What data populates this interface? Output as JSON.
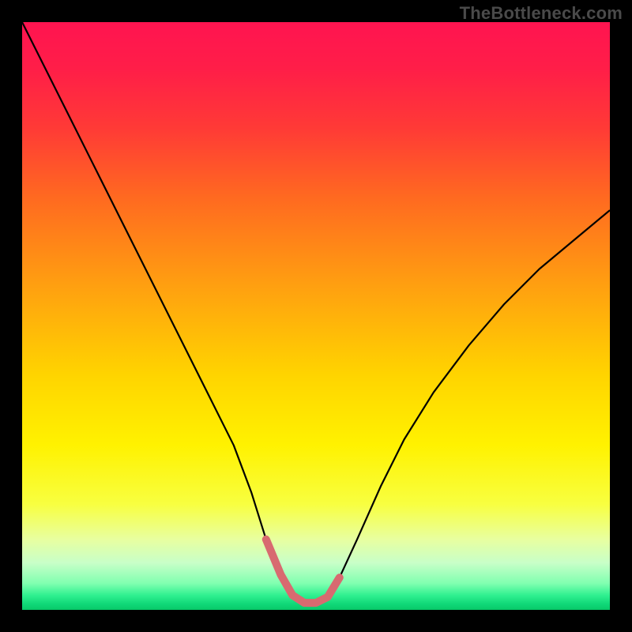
{
  "watermark": {
    "text": "TheBottleneck.com"
  },
  "gradient": {
    "stops": [
      {
        "offset": 0.0,
        "color": "#ff1450"
      },
      {
        "offset": 0.08,
        "color": "#ff1e48"
      },
      {
        "offset": 0.18,
        "color": "#ff3a36"
      },
      {
        "offset": 0.3,
        "color": "#ff6a20"
      },
      {
        "offset": 0.45,
        "color": "#ffa010"
      },
      {
        "offset": 0.6,
        "color": "#ffd400"
      },
      {
        "offset": 0.72,
        "color": "#fff200"
      },
      {
        "offset": 0.82,
        "color": "#f8ff40"
      },
      {
        "offset": 0.88,
        "color": "#e8ffa0"
      },
      {
        "offset": 0.92,
        "color": "#c8ffc8"
      },
      {
        "offset": 0.955,
        "color": "#80ffb0"
      },
      {
        "offset": 0.975,
        "color": "#30f090"
      },
      {
        "offset": 0.99,
        "color": "#10d878"
      },
      {
        "offset": 1.0,
        "color": "#08c868"
      }
    ]
  },
  "chart_data": {
    "type": "line",
    "title": "",
    "xlabel": "",
    "ylabel": "",
    "xlim": [
      0,
      100
    ],
    "ylim": [
      0,
      100
    ],
    "series": [
      {
        "name": "bottleneck-curve",
        "stroke": "#000000",
        "stroke_width": 2.2,
        "x": [
          0,
          4,
          8,
          12,
          16,
          20,
          24,
          28,
          32,
          36,
          39,
          41.5,
          44,
          46,
          48,
          50,
          52,
          54,
          57,
          61,
          65,
          70,
          76,
          82,
          88,
          94,
          100
        ],
        "y": [
          100,
          92,
          84,
          76,
          68,
          60,
          52,
          44,
          36,
          28,
          20,
          12,
          6,
          2.5,
          1.2,
          1.2,
          2.2,
          5.5,
          12,
          21,
          29,
          37,
          45,
          52,
          58,
          63,
          68
        ]
      },
      {
        "name": "bottom-highlight",
        "stroke": "#d86a70",
        "stroke_width": 10,
        "linecap": "round",
        "x": [
          41.5,
          44,
          46,
          48,
          50,
          52,
          54
        ],
        "y": [
          12,
          6,
          2.5,
          1.2,
          1.2,
          2.2,
          5.5
        ]
      }
    ]
  }
}
